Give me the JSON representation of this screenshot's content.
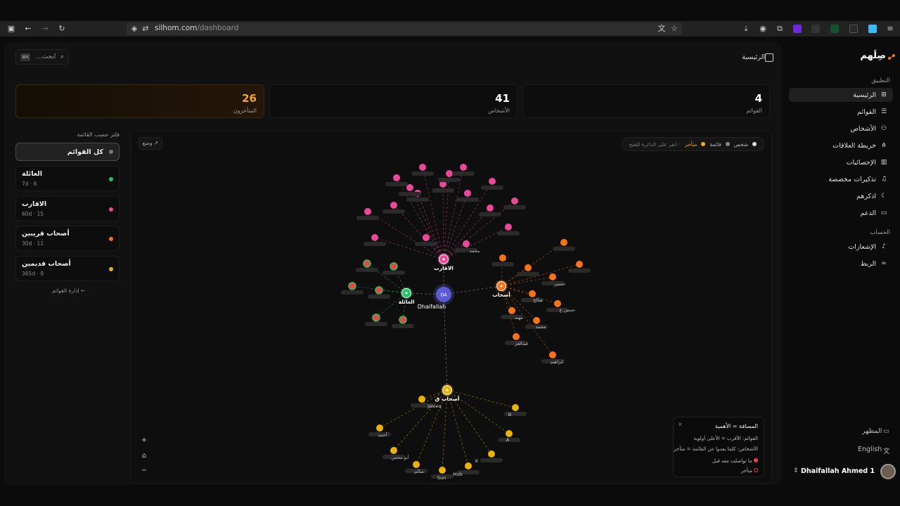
{
  "browser": {
    "url_host": "silhom.com",
    "url_path": "/dashboard"
  },
  "sidebar": {
    "brand": "صِلَهم",
    "section_app": "التطبيق",
    "items": [
      {
        "label": "الرئيسية",
        "icon": "grid-icon"
      },
      {
        "label": "القوائم",
        "icon": "list-icon"
      },
      {
        "label": "الأشخاص",
        "icon": "users-icon"
      },
      {
        "label": "خريطة العلاقات",
        "icon": "network-icon"
      },
      {
        "label": "الإحصائيات",
        "icon": "bar-chart-icon"
      },
      {
        "label": "تذكيرات مخصصة",
        "icon": "bell-icon"
      },
      {
        "label": "اذكرهم",
        "icon": "moon-icon"
      },
      {
        "label": "الدعم",
        "icon": "support-icon"
      }
    ],
    "section_account": "الحساب",
    "account_items": [
      {
        "label": "الإشعارات",
        "icon": "bell-ring-icon"
      },
      {
        "label": "الربط",
        "icon": "link-icon"
      }
    ],
    "appearance": "المظهر",
    "language": "English",
    "user_name": "Dhaifallah Ahmed 1"
  },
  "header": {
    "title": "الرئيسية",
    "search_placeholder": "ابحث...",
    "search_kbd": "⌘K"
  },
  "stats": {
    "lists_value": "4",
    "lists_label": "القوائم",
    "people_value": "41",
    "people_label": "الأشخاص",
    "overdue_value": "26",
    "overdue_label": "المتأخرون"
  },
  "filter": {
    "title": "فلتر حسب القائمة",
    "all": "كل القوائم",
    "lists": [
      {
        "name": "العائلة",
        "meta": "7d · 6",
        "color": "#22c55e"
      },
      {
        "name": "الاقارب",
        "meta": "60d · 15",
        "color": "#ec4899"
      },
      {
        "name": "أصحاب قريبين",
        "meta": "30d · 11",
        "color": "#f97316"
      },
      {
        "name": "أصحاب قديمين",
        "meta": "365d · 9",
        "color": "#eab308"
      }
    ],
    "manage": "إدارة القوائم ←"
  },
  "graph": {
    "mode_button": "وضع ↗",
    "legend_person": "شخص",
    "legend_list": "قائمة",
    "legend_overdue": "متأخر",
    "legend_hint": "· انقر على الدائرة للفتح",
    "center_initials": "DA",
    "center_label": "Dhaifallah",
    "hub_family": "العائلة",
    "hub_relatives": "الاقارب",
    "hub_friends": "أصحاب",
    "hub_old_friends": "أصحاب ق",
    "zoom_in": "+",
    "zoom_home": "⌂",
    "zoom_out": "−",
    "info_title": "المسافة = الأهمية",
    "info_line1": "القوائم: الأقرب = الأعلى أولوية",
    "info_line2": "الأشخاص: كلما بعدوا عن القائمة = متأخر",
    "info_contacted": "ما تواصلت معه قبل",
    "info_overdue": "متأخر",
    "node_labels": {
      "jaleeq": "Jaleeq",
      "b": "B",
      "a": "A",
      "k": "K",
      "mob": "Mob",
      "sun": "Sun",
      "ahmed": "أحمد",
      "abu_mohsen": "أبو محس",
      "salem": "سالم",
      "hussein": "حسين",
      "hussein_a": "حسين ع",
      "saleh": "صالح",
      "muhannad": "مهند",
      "mohammed": "محمد",
      "abdulaziz": "عبدالعز",
      "ibrahim": "ابراهيم",
      "mohammed2": "محمد"
    }
  },
  "colors": {
    "family": "#22c55e",
    "relatives": "#ec4899",
    "friends": "#f97316",
    "old_friends": "#eab308",
    "center": "#5b5bd6",
    "overdue": "#ef4444"
  }
}
